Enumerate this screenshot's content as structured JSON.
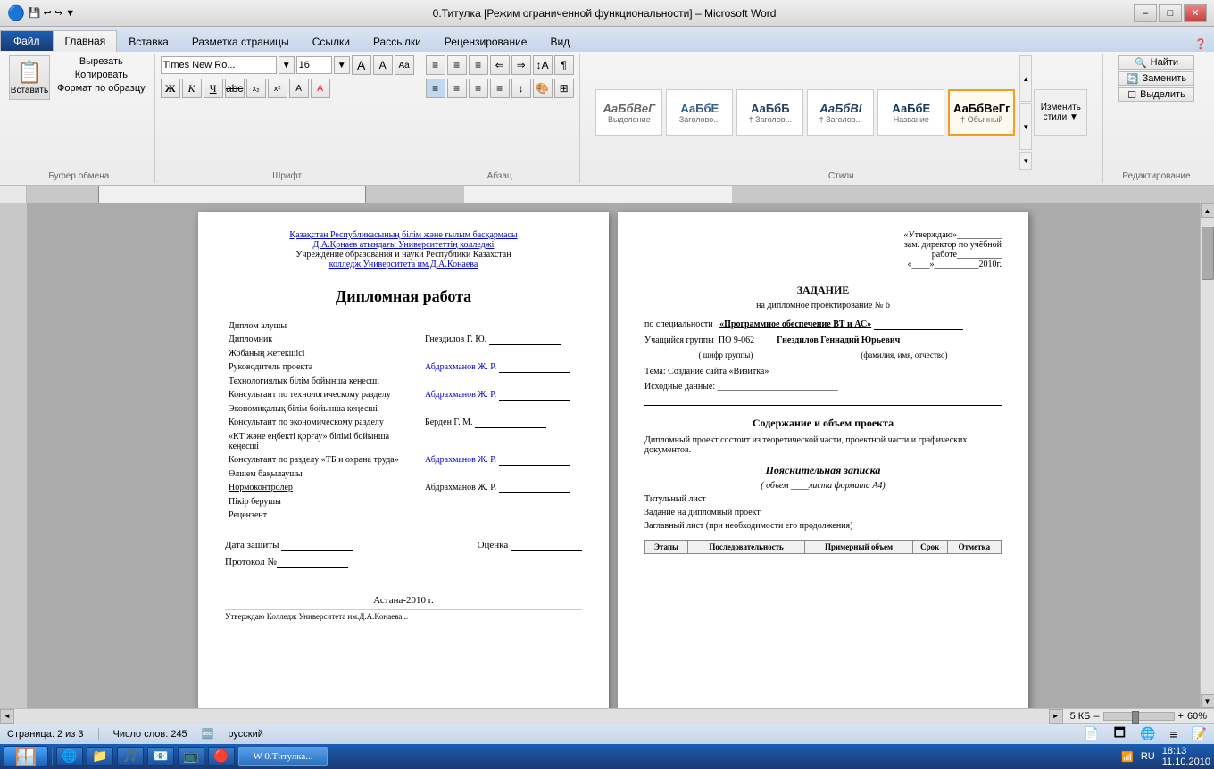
{
  "titlebar": {
    "title": "0.Титулка [Режим ограниченной функциональности] – Microsoft Word",
    "minimize": "–",
    "maximize": "□",
    "close": "✕"
  },
  "ribbon": {
    "tabs": [
      "Файл",
      "Главная",
      "Вставка",
      "Разметка страницы",
      "Ссылки",
      "Рассылки",
      "Рецензирование",
      "Вид"
    ],
    "active_tab": "Главная",
    "font": {
      "family": "Times New Ro...",
      "size": "16",
      "bold": "Ж",
      "italic": "К",
      "underline": "Ч",
      "strikethrough": "abc",
      "subscript": "x₂",
      "superscript": "x²"
    },
    "clipboard": {
      "paste": "Вставить",
      "cut": "Вырезать",
      "copy": "Копировать",
      "format": "Формат по образцу"
    },
    "groups": {
      "clipboard": "Буфер обмена",
      "font": "Шрифт",
      "paragraph": "Абзац",
      "styles": "Стили",
      "editing": "Редактирование"
    },
    "styles": [
      {
        "label": "Выделение",
        "preview": "АаБбВеГ"
      },
      {
        "label": "Заголово...",
        "preview": "АаБбЕ"
      },
      {
        "label": "† Заголов...",
        "preview": "АаБбБ"
      },
      {
        "label": "† Заголов...",
        "preview": "АаБбВI"
      },
      {
        "label": "Название",
        "preview": "АаБбЕ"
      },
      {
        "label": "† Обычный",
        "preview": "АаБбВеГг",
        "active": true
      }
    ],
    "editing": {
      "find": "Найти",
      "replace": "Заменить",
      "select": "Выделить"
    }
  },
  "pages": {
    "page1": {
      "header_line1": "Қазақстан Республикасының білім және ғылым басқармасы",
      "header_line2": "Д.А.Қонаев атындағы Университеттің колледжі",
      "header_line3": "Учреждение образования и науки Республики Казахстан",
      "header_line4": "колледж Университета им.Д.А.Конаева",
      "title": "Дипломная работа",
      "fields": [
        {
          "label": "Диплом алушы"
        },
        {
          "label": "Дипломник",
          "value": "Гнездилов Г. Ю. ________"
        },
        {
          "label": "Жобаның жетекшісі"
        },
        {
          "label": "Руководитель проекта",
          "value": "Абдрахманов Ж. Р. ________"
        },
        {
          "label": "Технологиялық білім бойынша кеңесші"
        },
        {
          "label": "Консультант по технологическому разделу",
          "value": "Абдрахманов Ж. Р. ________"
        },
        {
          "label": "Экономиқалық білім бойынша кеңесші"
        },
        {
          "label": "Консультант по экономическому разделу",
          "value": "Берден Г. М. ________"
        },
        {
          "label": "«КТ және еңбекті қорғау» білімі бойынша кеңесші"
        },
        {
          "label": "Консультант по разделу «ТБ и охрана труда»",
          "value": "Абдрахманов Ж. Р. ________"
        },
        {
          "label": "Өлшем бақылаушы"
        },
        {
          "label": "Нормоконтролер",
          "value": "Абдрахманов Ж. Р. ________"
        },
        {
          "label": "Пікір берушы"
        },
        {
          "label": "Рецензент"
        }
      ],
      "bottom": {
        "date_label": "Дата защиты",
        "date_value": "________",
        "grade_label": "Оценка",
        "grade_value": "________"
      },
      "protocol": "Протокол №________",
      "city": "Астана-2010 г.",
      "footer_partial": "Утверждаю  Колледж Университета им.Д.А.Конаева..."
    },
    "page2": {
      "top_right": {
        "line1": "«Утверждаю»__________",
        "line2": "зам. директор по учёбной",
        "line3": "работе__________",
        "line4": "«____»__________2010г."
      },
      "heading": "ЗАДАНИЕ",
      "subheading": "на дипломное проектирование № 6",
      "specialty_label": "по специальности",
      "specialty_value": "«Программное обеспечение ВТ и АС»",
      "group_label": "Учащийся группы",
      "group_value": "ПО 9-062",
      "name_value": "Гнездилов Геннадий Юрьевич",
      "group_caption": "( шифр группы)",
      "name_caption": "(фамилия, имя, отчество)",
      "topic_label": "Тема: Создание сайта «Визитка»",
      "initial_data_label": "Исходные данные: ___________________________",
      "content_heading": "Содержание и объем проекта",
      "content_text": "Дипломный проект состоит из теоретической части, проектной части и графических документов.",
      "note_heading": "Пояснительная записка",
      "note_subtext": "( объем ____листа формата А4)",
      "item1": "Титульный лист",
      "item2": "Задание на дипломный проект",
      "item3": "Заглавный лист (при необходимости его продолжения)",
      "table_header": {
        "col1": "Этапы",
        "col2": "Последовательность",
        "col3": "Примерный объем",
        "col4": "Срок",
        "col5": "Отметка"
      }
    }
  },
  "statusbar": {
    "page": "Страница: 2 из 3",
    "words": "Число слов: 245",
    "lang": "русский",
    "file_size": "5 КБ",
    "zoom": "60%"
  },
  "taskbar": {
    "apps": [
      "🪟",
      "🌐",
      "📁",
      "🎵",
      "📧",
      "📺",
      "🔵",
      "W"
    ],
    "tray": {
      "lang": "RU",
      "time": "18:13",
      "date": "11.10.2010"
    }
  }
}
